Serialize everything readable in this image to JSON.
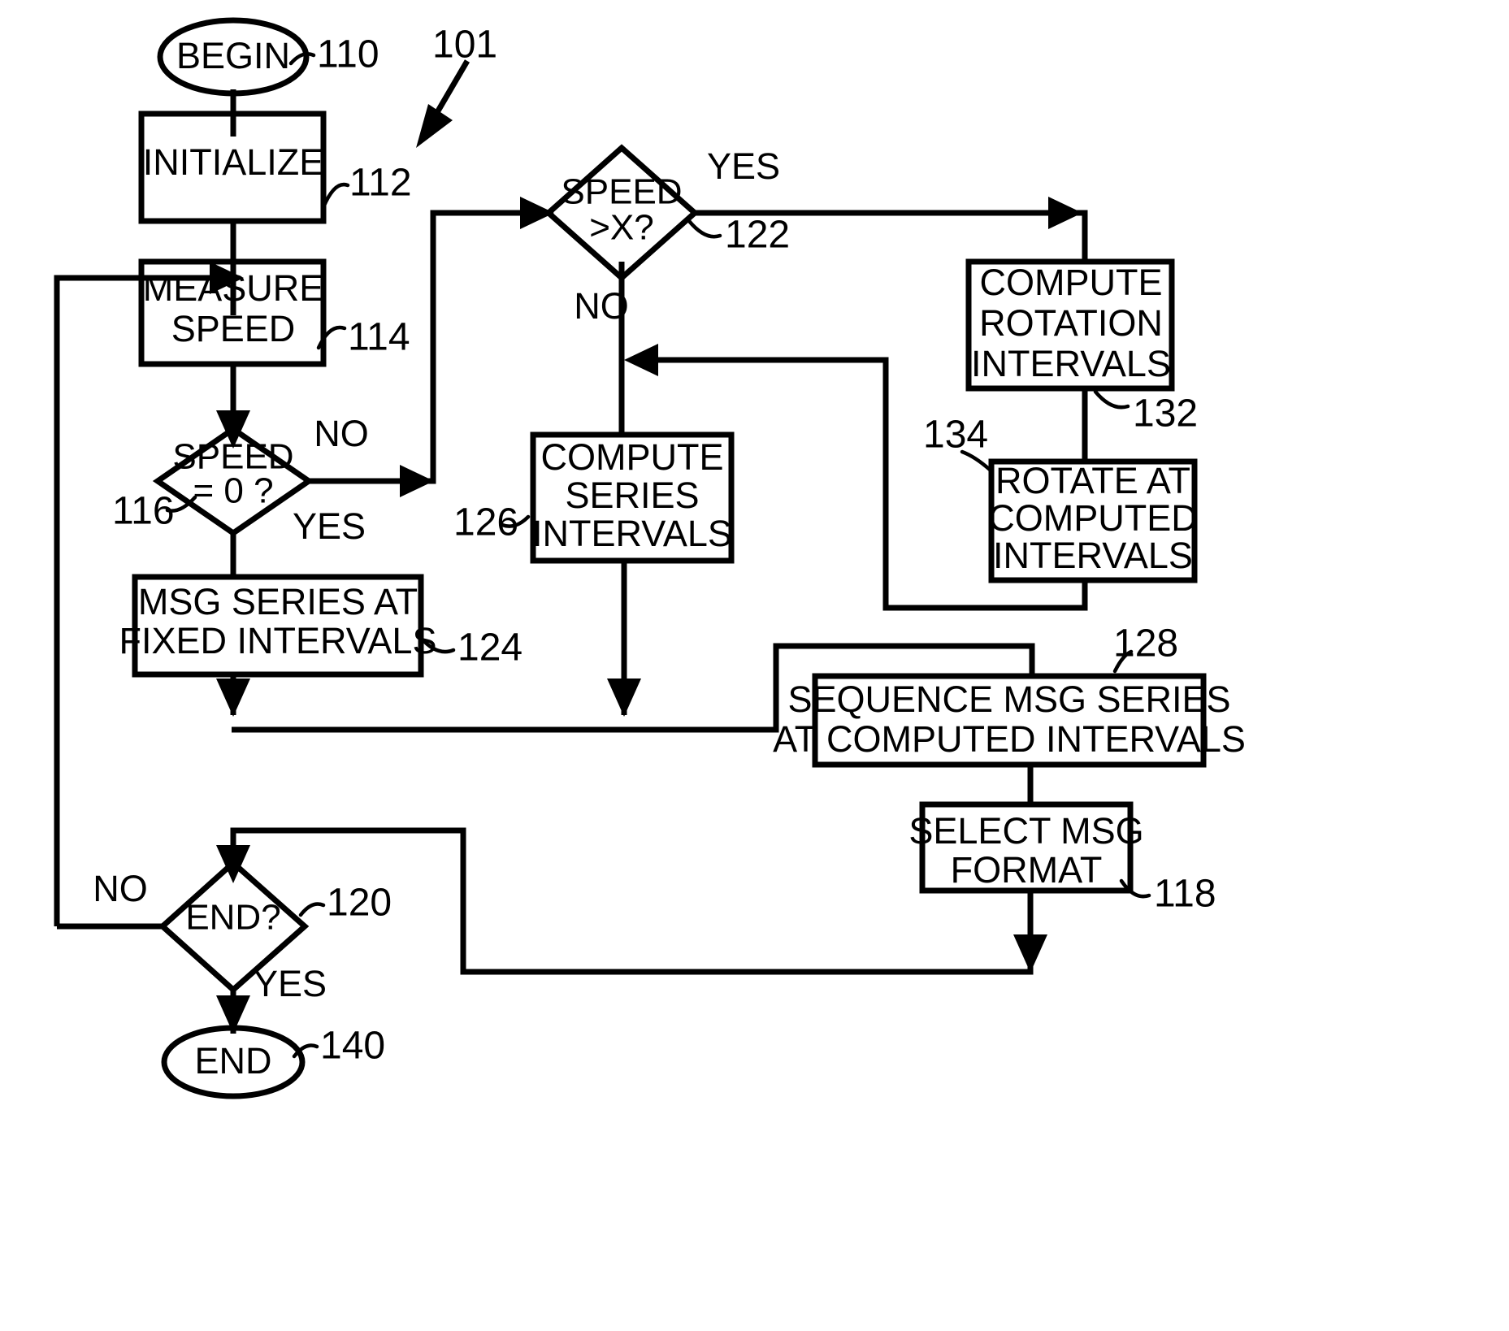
{
  "figure": {
    "reference_numeral": "101",
    "title": "Flowchart 101"
  },
  "nodes": {
    "begin": {
      "label": "BEGIN",
      "ref": "110",
      "shape": "terminator"
    },
    "initialize": {
      "label": "INITIALIZE",
      "ref": "112",
      "shape": "process"
    },
    "measure_speed": {
      "line1": "MEASURE",
      "line2": "SPEED",
      "ref": "114",
      "shape": "process"
    },
    "speed_zero": {
      "line1": "SPEED",
      "line2": "= 0 ?",
      "ref": "116",
      "shape": "decision"
    },
    "speed_gt_x": {
      "line1": "SPEED",
      "line2": ">X?",
      "ref": "122",
      "shape": "decision"
    },
    "msg_series_fixed": {
      "line1": "MSG SERIES AT",
      "line2": "FIXED INTERVALS",
      "ref": "124",
      "shape": "process"
    },
    "compute_series": {
      "line1": "COMPUTE",
      "line2": "SERIES",
      "line3": "INTERVALS",
      "ref": "126",
      "shape": "process"
    },
    "compute_rotation": {
      "line1": "COMPUTE",
      "line2": "ROTATION",
      "line3": "INTERVALS",
      "ref": "132",
      "shape": "process"
    },
    "rotate_at_computed": {
      "line1": "ROTATE AT",
      "line2": "COMPUTED",
      "line3": "INTERVALS",
      "ref": "134",
      "shape": "process"
    },
    "sequence_msg": {
      "line1": "SEQUENCE MSG SERIES",
      "line2": "AT COMPUTED INTERVALS",
      "ref": "128",
      "shape": "process"
    },
    "select_msg_format": {
      "line1": "SELECT MSG",
      "line2": "FORMAT",
      "ref": "118",
      "shape": "process"
    },
    "end_decision": {
      "label": "END?",
      "ref": "120",
      "shape": "decision"
    },
    "end": {
      "label": "END",
      "ref": "140",
      "shape": "terminator"
    }
  },
  "edge_labels": {
    "speed_zero_no": "NO",
    "speed_zero_yes": "YES",
    "speed_gt_x_yes": "YES",
    "speed_gt_x_no": "NO",
    "end_no": "NO",
    "end_yes": "YES"
  },
  "colors": {
    "stroke": "#000000",
    "background": "#ffffff",
    "text": "#000000"
  }
}
